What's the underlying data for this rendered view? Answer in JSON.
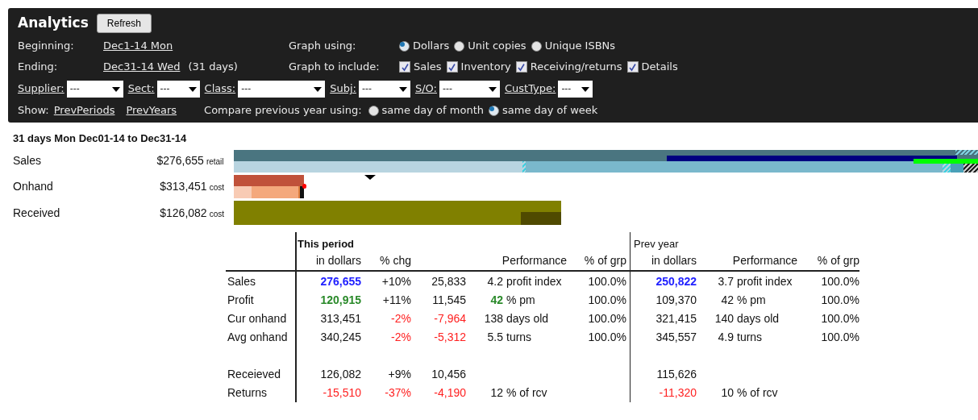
{
  "header": {
    "title": "Analytics",
    "refresh_button": "Refresh",
    "beginning": {
      "label": "Beginning:",
      "value": "Dec1-14 Mon"
    },
    "ending": {
      "label": "Ending:",
      "value": "Dec31-14 Wed",
      "days": "(31 days)"
    },
    "graph_using": {
      "label": "Graph using:",
      "options": [
        {
          "label": "Dollars",
          "selected": true
        },
        {
          "label": "Unit copies",
          "selected": false
        },
        {
          "label": "Unique ISBNs",
          "selected": false
        }
      ]
    },
    "graph_include": {
      "label": "Graph to include:",
      "options": [
        {
          "label": "Sales",
          "checked": true
        },
        {
          "label": "Inventory",
          "checked": true
        },
        {
          "label": "Receiving/returns",
          "checked": true
        },
        {
          "label": "Details",
          "checked": true
        }
      ]
    },
    "filters": [
      {
        "label": "Supplier:",
        "value": "---"
      },
      {
        "label": "Sect:",
        "value": "---"
      },
      {
        "label": "Class:",
        "value": "---"
      },
      {
        "label": "Subj:",
        "value": "---"
      },
      {
        "label": "S/O:",
        "value": "---"
      },
      {
        "label": "CustType:",
        "value": "---"
      }
    ],
    "show": {
      "label": "Show:",
      "links": [
        "PrevPeriods",
        "PrevYears"
      ]
    },
    "compare": {
      "label": "Compare previous year using:",
      "options": [
        {
          "label": "same day of month",
          "selected": false
        },
        {
          "label": "same day of week",
          "selected": true
        }
      ]
    }
  },
  "summary": {
    "title": "31 days Mon Dec01-14 to Dec31-14",
    "rows": [
      {
        "label": "Sales",
        "amount": "$276,655",
        "unit": "retail"
      },
      {
        "label": "Onhand",
        "amount": "$313,451",
        "unit": "cost"
      },
      {
        "label": "Received",
        "amount": "$126,082",
        "unit": "cost"
      }
    ]
  },
  "table": {
    "this_period": {
      "title": "This period",
      "in_dollars": "in dollars",
      "pct_chg": "% chg",
      "performance": "Performance",
      "pct_grp": "% of grp"
    },
    "prev_year": {
      "title": "Prev year",
      "in_dollars": "in dollars",
      "performance": "Performance",
      "pct_grp": "% of grp"
    },
    "sections": [
      [
        {
          "label": "Sales",
          "amount": {
            "text": "276,655",
            "color": "#2020ff",
            "bold": true
          },
          "chg": {
            "text": "+10%",
            "color": "#111111",
            "bold": false
          },
          "units": {
            "text": "25,833",
            "color": "#111111",
            "bold": false
          },
          "perf": {
            "value": "4.2",
            "color": "#111111",
            "bold": false,
            "text": "profit index"
          },
          "grp": "100.0%",
          "prev_amount": {
            "text": "250,822",
            "color": "#2020ff",
            "bold": true
          },
          "prev_perf": {
            "value": "3.7",
            "text": "profit index"
          },
          "prev_grp": "100.0%"
        },
        {
          "label": "Profit",
          "amount": {
            "text": "120,915",
            "color": "#2a8a2a",
            "bold": true
          },
          "chg": {
            "text": "+11%",
            "color": "#111111",
            "bold": false
          },
          "units": {
            "text": "11,545",
            "color": "#111111",
            "bold": false
          },
          "perf": {
            "value": "42",
            "color": "#2a8a2a",
            "bold": true,
            "text": "% pm"
          },
          "grp": "100.0%",
          "prev_amount": {
            "text": "109,370",
            "color": "#111111",
            "bold": false
          },
          "prev_perf": {
            "value": "42",
            "text": "% pm"
          },
          "prev_grp": "100.0%"
        },
        {
          "label": "Cur onhand",
          "amount": {
            "text": "313,451",
            "color": "#111111",
            "bold": false
          },
          "chg": {
            "text": "-2%",
            "color": "#ff2020",
            "bold": false
          },
          "units": {
            "text": "-7,964",
            "color": "#ff2020",
            "bold": false
          },
          "perf": {
            "value": "138",
            "color": "#111111",
            "bold": false,
            "text": "days old"
          },
          "grp": "100.0%",
          "prev_amount": {
            "text": "321,415",
            "color": "#111111",
            "bold": false
          },
          "prev_perf": {
            "value": "140",
            "text": "days old"
          },
          "prev_grp": "100.0%"
        },
        {
          "label": "Avg onhand",
          "amount": {
            "text": "340,245",
            "color": "#111111",
            "bold": false
          },
          "chg": {
            "text": "-2%",
            "color": "#ff2020",
            "bold": false
          },
          "units": {
            "text": "-5,312",
            "color": "#ff2020",
            "bold": false
          },
          "perf": {
            "value": "5.5",
            "color": "#111111",
            "bold": false,
            "text": "turns"
          },
          "grp": "100.0%",
          "prev_amount": {
            "text": "345,557",
            "color": "#111111",
            "bold": false
          },
          "prev_perf": {
            "value": "4.9",
            "text": "turns"
          },
          "prev_grp": "100.0%"
        }
      ],
      [
        {
          "label": "Receieved",
          "amount": {
            "text": "126,082",
            "color": "#111111",
            "bold": false
          },
          "chg": {
            "text": "+9%",
            "color": "#111111",
            "bold": false
          },
          "units": {
            "text": "10,456",
            "color": "#111111",
            "bold": false
          },
          "prev_amount": {
            "text": "115,626",
            "color": "#111111",
            "bold": false
          }
        },
        {
          "label": "Returns",
          "amount": {
            "text": "-15,510",
            "color": "#ff2020",
            "bold": false
          },
          "chg": {
            "text": "-37%",
            "color": "#ff2020",
            "bold": false
          },
          "units": {
            "text": "-4,190",
            "color": "#ff2020",
            "bold": false
          },
          "perf": {
            "value": "12",
            "color": "#111111",
            "bold": false,
            "text": "% of rcv"
          },
          "prev_amount": {
            "text": "-11,320",
            "color": "#ff2020",
            "bold": false
          },
          "prev_perf": {
            "value": "10",
            "text": "% of rcv"
          }
        }
      ]
    ]
  }
}
